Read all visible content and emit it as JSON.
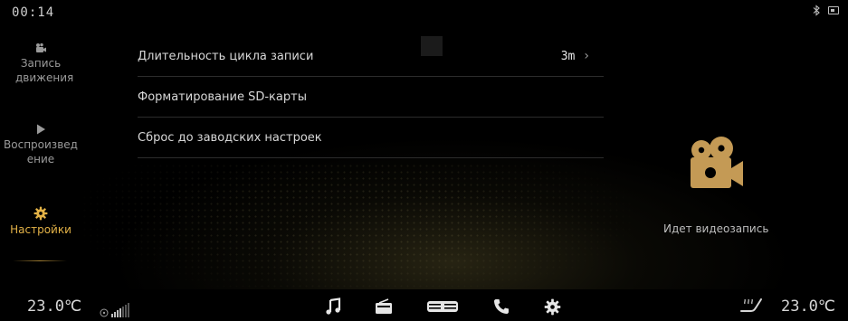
{
  "status_bar": {
    "time": "00:14",
    "icons": [
      "bluetooth-icon",
      "battery-icon"
    ]
  },
  "sidebar": {
    "items": [
      {
        "label": "Запись движения",
        "icon": "video-camera-icon",
        "active": false
      },
      {
        "label": "Воспроизведение",
        "icon": "play-icon",
        "active": false
      },
      {
        "label": "Настройки",
        "icon": "gear-icon",
        "active": true
      }
    ]
  },
  "settings": {
    "rows": [
      {
        "label": "Длительность цикла записи",
        "value": "3m"
      },
      {
        "label": "Форматирование SD-карты",
        "value": ""
      },
      {
        "label": "Сброс до заводских настроек",
        "value": ""
      }
    ]
  },
  "recording": {
    "status_text": "Идет видеозапись",
    "icon": "movie-camera-icon"
  },
  "bottom_bar": {
    "temp_left": "23.0℃",
    "temp_right": "23.0℃",
    "fan_level": 0.4,
    "dock_icons": [
      "music-note-icon",
      "radio-icon",
      "car-grille-icon",
      "phone-icon",
      "gear-icon"
    ],
    "seat_icon": "heated-seat-icon"
  },
  "colors": {
    "accent": "#e3b247",
    "camera_gold": "#c49a55",
    "background": "#000000",
    "divider": "#2c2c2c"
  }
}
